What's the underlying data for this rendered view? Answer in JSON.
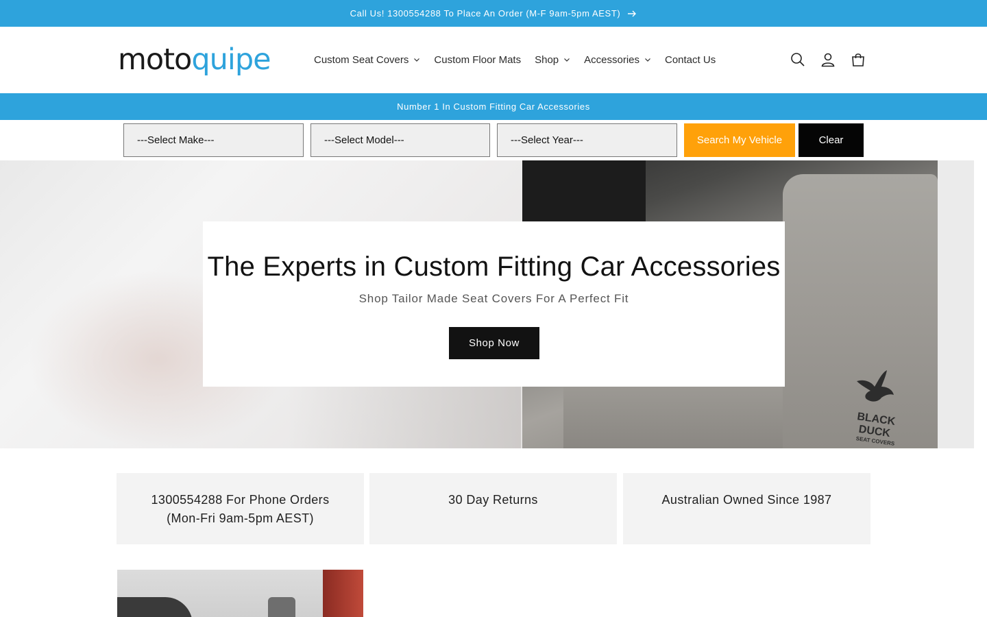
{
  "announcement": {
    "text": "Call Us! 1300554288 To Place An Order (M-F 9am-5pm AEST)"
  },
  "header": {
    "logo": {
      "part1": "moto",
      "part2": "quipe"
    },
    "nav": [
      {
        "label": "Custom Seat Covers",
        "has_dropdown": true
      },
      {
        "label": "Custom Floor Mats",
        "has_dropdown": false
      },
      {
        "label": "Shop",
        "has_dropdown": true
      },
      {
        "label": "Accessories",
        "has_dropdown": true
      },
      {
        "label": "Contact Us",
        "has_dropdown": false
      }
    ],
    "icons": [
      "search-icon",
      "account-icon",
      "cart-icon"
    ]
  },
  "subbar": {
    "text": "Number 1 In Custom Fitting Car Accessories"
  },
  "vehicle_finder": {
    "make": "---Select Make---",
    "model": "---Select Model---",
    "year": "---Select Year---",
    "search_label": "Search My Vehicle",
    "clear_label": "Clear"
  },
  "hero": {
    "title": "The Experts in Custom Fitting Car Accessories",
    "subtitle": "Shop Tailor Made Seat Covers For A Perfect Fit",
    "cta": "Shop Now",
    "brand_name": "BLACK DUCK",
    "brand_sub": "SEAT COVERS"
  },
  "features": [
    {
      "text": "1300554288 For Phone Orders (Mon-Fri 9am-5pm AEST)"
    },
    {
      "text": "30 Day Returns"
    },
    {
      "text": "Australian Owned Since 1987"
    }
  ],
  "colors": {
    "accent_blue": "#2ea3dc",
    "search_orange": "#ffa10a",
    "clear_black": "#050505",
    "text_dark": "#121212"
  }
}
